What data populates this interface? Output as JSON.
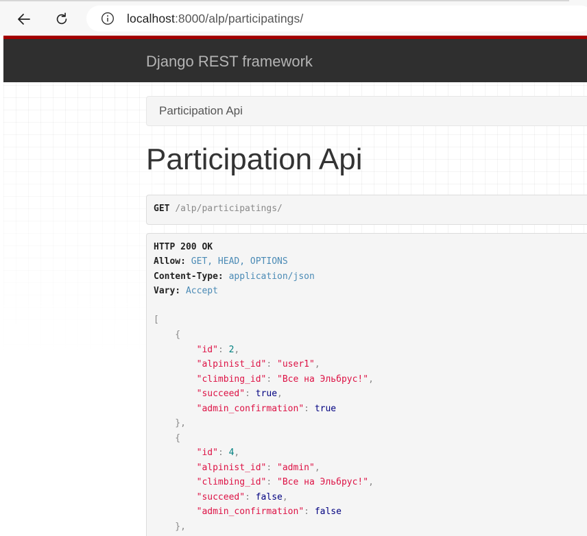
{
  "browser": {
    "url_host": "localhost",
    "url_rest": ":8000/alp/participatings/"
  },
  "navbar": {
    "brand": "Django REST framework"
  },
  "breadcrumb": {
    "item": "Participation Api"
  },
  "page": {
    "title": "Participation Api"
  },
  "request": {
    "method": "GET",
    "path": "/alp/participatings/"
  },
  "response": {
    "status": "HTTP 200 OK",
    "headers": [
      {
        "name": "Allow:",
        "value": "GET, HEAD, OPTIONS"
      },
      {
        "name": "Content-Type:",
        "value": "application/json"
      },
      {
        "name": "Vary:",
        "value": "Accept"
      }
    ],
    "items": [
      {
        "id": "2",
        "alpinist_id": "\"user1\"",
        "climbing_id": "\"Все на Эльбрус!\"",
        "succeed": "true",
        "admin_confirmation": "true"
      },
      {
        "id": "4",
        "alpinist_id": "\"admin\"",
        "climbing_id": "\"Все на Эльбрус!\"",
        "succeed": "false",
        "admin_confirmation": "false"
      }
    ]
  },
  "keys": {
    "id": "\"id\"",
    "alpinist_id": "\"alpinist_id\"",
    "climbing_id": "\"climbing_id\"",
    "succeed": "\"succeed\"",
    "admin_confirmation": "\"admin_confirmation\""
  }
}
